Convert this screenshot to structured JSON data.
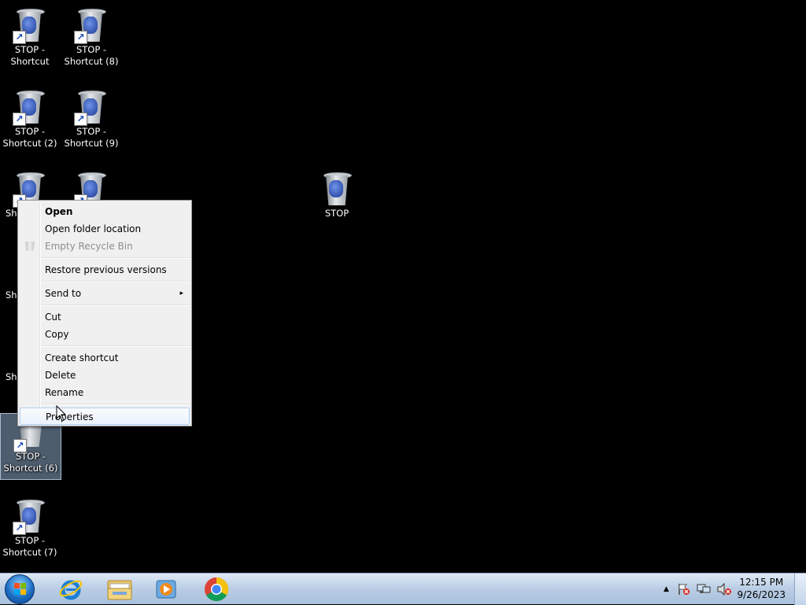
{
  "desktop": {
    "icons": [
      {
        "line1": "STOP -",
        "line2": "Shortcut"
      },
      {
        "line1": "STOP -",
        "line2": "Shortcut (8)"
      },
      {
        "line1": "STOP -",
        "line2": "Shortcut (2)"
      },
      {
        "line1": "STOP -",
        "line2": "Shortcut (9)"
      },
      {
        "line1": "Sh",
        "line2": ""
      },
      {
        "line1": "",
        "line2": ""
      },
      {
        "line1": "STOP",
        "line2": ""
      },
      {
        "line1": "Sh",
        "line2": ""
      },
      {
        "line1": "Sh",
        "line2": ""
      },
      {
        "line1": "STOP -",
        "line2": "Shortcut (6)"
      },
      {
        "line1": "STOP -",
        "line2": "Shortcut (7)"
      }
    ]
  },
  "context_menu": {
    "items": [
      {
        "label": "Open"
      },
      {
        "label": "Open folder location"
      },
      {
        "label": "Empty Recycle Bin"
      },
      {
        "label": "Restore previous versions"
      },
      {
        "label": "Send to",
        "submenu_arrow": "▸"
      },
      {
        "label": "Cut"
      },
      {
        "label": "Copy"
      },
      {
        "label": "Create shortcut"
      },
      {
        "label": "Delete"
      },
      {
        "label": "Rename"
      },
      {
        "label": "Properties"
      }
    ]
  },
  "taskbar": {
    "apps": [
      {
        "name": "internet-explorer-icon"
      },
      {
        "name": "windows-explorer-icon"
      },
      {
        "name": "media-player-icon"
      },
      {
        "name": "chrome-icon"
      }
    ],
    "tray": {
      "show_hidden_arrow": "▲",
      "time": "12:15 PM",
      "date": "9/26/2023"
    }
  },
  "colors": {
    "desktop_bg": "#000000",
    "menu_bg": "#f0f0f0",
    "taskbar": "#b9cde4",
    "selection": "#8caac8"
  }
}
